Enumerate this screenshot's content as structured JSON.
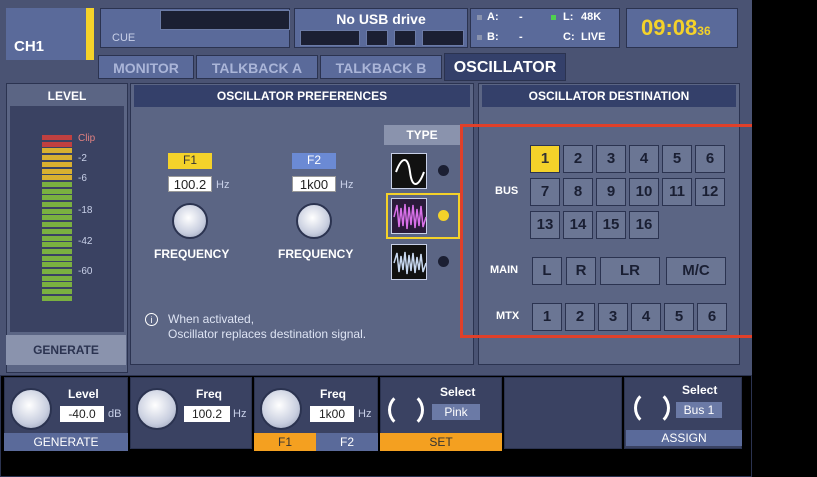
{
  "header": {
    "channel": "CH1",
    "cue_label": "CUE",
    "usb_status": "No USB drive",
    "bus_a_label": "A:",
    "bus_a_value": "-",
    "bus_b_label": "B:",
    "bus_b_value": "-",
    "rate_label": "L:",
    "rate_value": "48K",
    "clock_source_label": "C:",
    "clock_source_value": "LIVE",
    "time_main": "09:08",
    "time_seconds": "36"
  },
  "tabs": [
    "MONITOR",
    "TALKBACK A",
    "TALKBACK B",
    "OSCILLATOR"
  ],
  "active_tab": "OSCILLATOR",
  "level_panel": {
    "title": "LEVEL",
    "scale": [
      "Clip",
      "-2",
      "-6",
      "-18",
      "-42",
      "-60"
    ],
    "generate_label": "GENERATE"
  },
  "preferences": {
    "title": "OSCILLATOR PREFERENCES",
    "f1_tag": "F1",
    "f1_value": "100.2",
    "f1_unit": "Hz",
    "f1_label": "FREQUENCY",
    "f2_tag": "F2",
    "f2_value": "1k00",
    "f2_unit": "Hz",
    "f2_label": "FREQUENCY",
    "type_title": "TYPE",
    "types": [
      "sine-wave-icon",
      "pink-noise-icon",
      "burst-noise-icon"
    ],
    "selected_type_index": 1,
    "note_line1": "When activated,",
    "note_line2": "Oscillator replaces destination signal."
  },
  "destination": {
    "title": "OSCILLATOR DESTINATION",
    "bus_label": "BUS",
    "bus_buttons": [
      "1",
      "2",
      "3",
      "4",
      "5",
      "6",
      "7",
      "8",
      "9",
      "10",
      "11",
      "12",
      "13",
      "14",
      "15",
      "16"
    ],
    "selected_bus": "1",
    "main_label": "MAIN",
    "main_buttons": [
      "L",
      "R",
      "LR",
      "M/C"
    ],
    "mtx_label": "MTX",
    "mtx_buttons": [
      "1",
      "2",
      "3",
      "4",
      "5",
      "6"
    ],
    "highlight_color": "#e0402a"
  },
  "bottom": {
    "level_label": "Level",
    "level_value": "-40.0",
    "level_unit": "dB",
    "generate_label": "GENERATE",
    "freq1_label": "Freq",
    "freq1_value": "100.2",
    "freq1_unit": "Hz",
    "freq2_label": "Freq",
    "freq2_value": "1k00",
    "freq2_unit": "Hz",
    "f1_button": "F1",
    "f2_button": "F2",
    "select_label": "Select",
    "select_value": "Pink",
    "set_label": "SET",
    "assign_select_label": "Select",
    "assign_select_value": "Bus 1",
    "assign_label": "ASSIGN"
  },
  "colors": {
    "accent_yellow": "#f4d22a",
    "panel": "#5b6584",
    "dark_panel": "#34406a"
  }
}
